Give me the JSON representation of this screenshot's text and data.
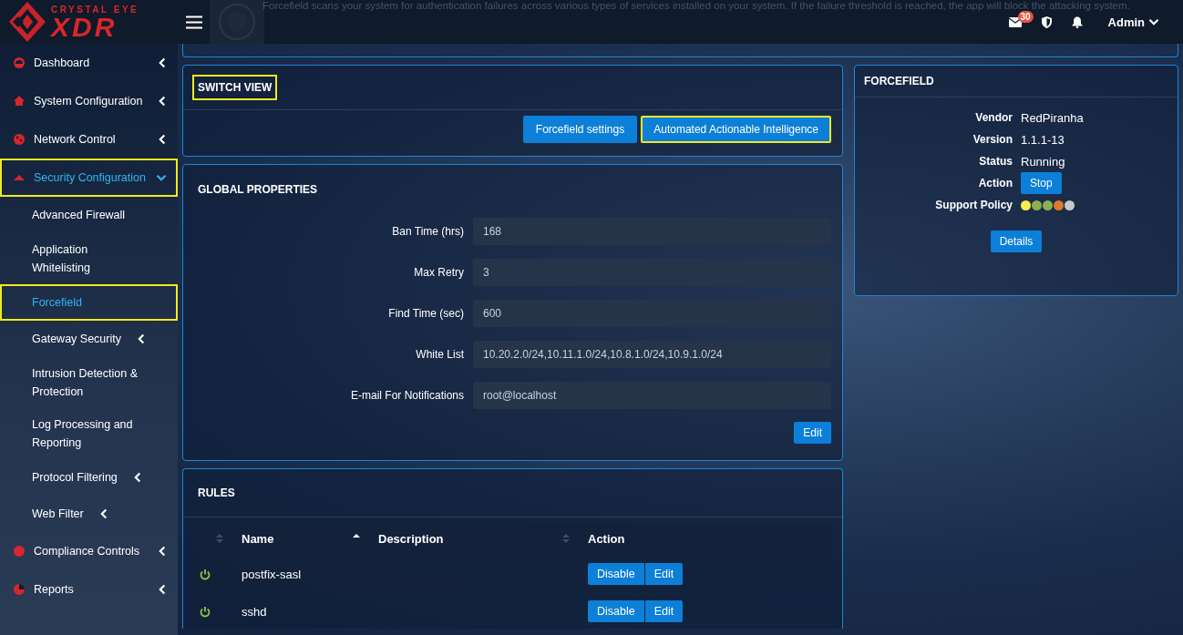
{
  "header": {
    "brand_top": "CRYSTAL EYE",
    "brand_main": "XDR",
    "intro": "Forcefield scans your system for authentication failures across various types of services installed on your system. If the failure threshold is reached, the app will block the attacking system.",
    "mail_count": "30",
    "user": "Admin"
  },
  "sidebar": {
    "items": [
      {
        "label": "Dashboard",
        "selected": false,
        "highlighted": false,
        "expanded": false,
        "has_children": true
      },
      {
        "label": "System Configuration",
        "selected": false,
        "highlighted": false,
        "expanded": false,
        "has_children": true
      },
      {
        "label": "Network Control",
        "selected": false,
        "highlighted": false,
        "expanded": false,
        "has_children": true
      },
      {
        "label": "Security Configuration",
        "selected": true,
        "highlighted": true,
        "expanded": true,
        "has_children": true,
        "children": [
          {
            "label": "Advanced Firewall",
            "selected": false,
            "highlighted": false,
            "has_children": false
          },
          {
            "label": "Application Whitelisting",
            "selected": false,
            "highlighted": false,
            "has_children": false
          },
          {
            "label": "Forcefield",
            "selected": true,
            "highlighted": true,
            "has_children": false
          },
          {
            "label": "Gateway Security",
            "selected": false,
            "highlighted": false,
            "has_children": true
          },
          {
            "label": "Intrusion Detection & Protection",
            "selected": false,
            "highlighted": false,
            "has_children": false
          },
          {
            "label": "Log Processing and Reporting",
            "selected": false,
            "highlighted": false,
            "has_children": false
          },
          {
            "label": "Protocol Filtering",
            "selected": false,
            "highlighted": false,
            "has_children": true
          },
          {
            "label": "Web Filter",
            "selected": false,
            "highlighted": false,
            "has_children": true
          }
        ]
      },
      {
        "label": "Compliance Controls",
        "selected": false,
        "highlighted": false,
        "expanded": false,
        "has_children": true
      },
      {
        "label": "Reports",
        "selected": false,
        "highlighted": false,
        "expanded": false,
        "has_children": true
      }
    ]
  },
  "switch_view": {
    "title": "SWITCH VIEW",
    "title_highlighted": true,
    "buttons": [
      {
        "label": "Forcefield settings",
        "highlighted": false
      },
      {
        "label": "Automated Actionable Intelligence",
        "highlighted": true
      }
    ]
  },
  "global_properties": {
    "title": "GLOBAL PROPERTIES",
    "fields": [
      {
        "label": "Ban Time (hrs)",
        "value": "168"
      },
      {
        "label": "Max Retry",
        "value": "3"
      },
      {
        "label": "Find Time (sec)",
        "value": "600"
      },
      {
        "label": "White List",
        "value": "10.20.2.0/24,10.11.1.0/24,10.8.1.0/24,10.9.1.0/24"
      },
      {
        "label": "E-mail For Notifications",
        "value": "root@localhost"
      }
    ],
    "edit_button": "Edit"
  },
  "rules": {
    "title": "RULES",
    "columns": [
      "Name",
      "Description",
      "Action"
    ],
    "rows": [
      {
        "name": "postfix-sasl",
        "description": "",
        "enabled": true,
        "buttons": [
          "Disable",
          "Edit"
        ]
      },
      {
        "name": "sshd",
        "description": "",
        "enabled": true,
        "buttons": [
          "Disable",
          "Edit"
        ]
      }
    ]
  },
  "forcefield": {
    "title": "FORCEFIELD",
    "info": [
      {
        "kind": "text",
        "label": "Vendor",
        "value": "RedPiranha"
      },
      {
        "kind": "text",
        "label": "Version",
        "value": "1.1.1-13"
      },
      {
        "kind": "text",
        "label": "Status",
        "value": "Running"
      },
      {
        "kind": "button",
        "label": "Action",
        "value": "Stop"
      },
      {
        "kind": "dots",
        "label": "Support Policy",
        "dots": [
          {
            "color": "#f5f04a"
          },
          {
            "color": "#8db04f"
          },
          {
            "color": "#8db04f"
          },
          {
            "color": "#e0782a"
          },
          {
            "color": "#c8c8c8"
          }
        ]
      }
    ],
    "details_button": "Details"
  }
}
